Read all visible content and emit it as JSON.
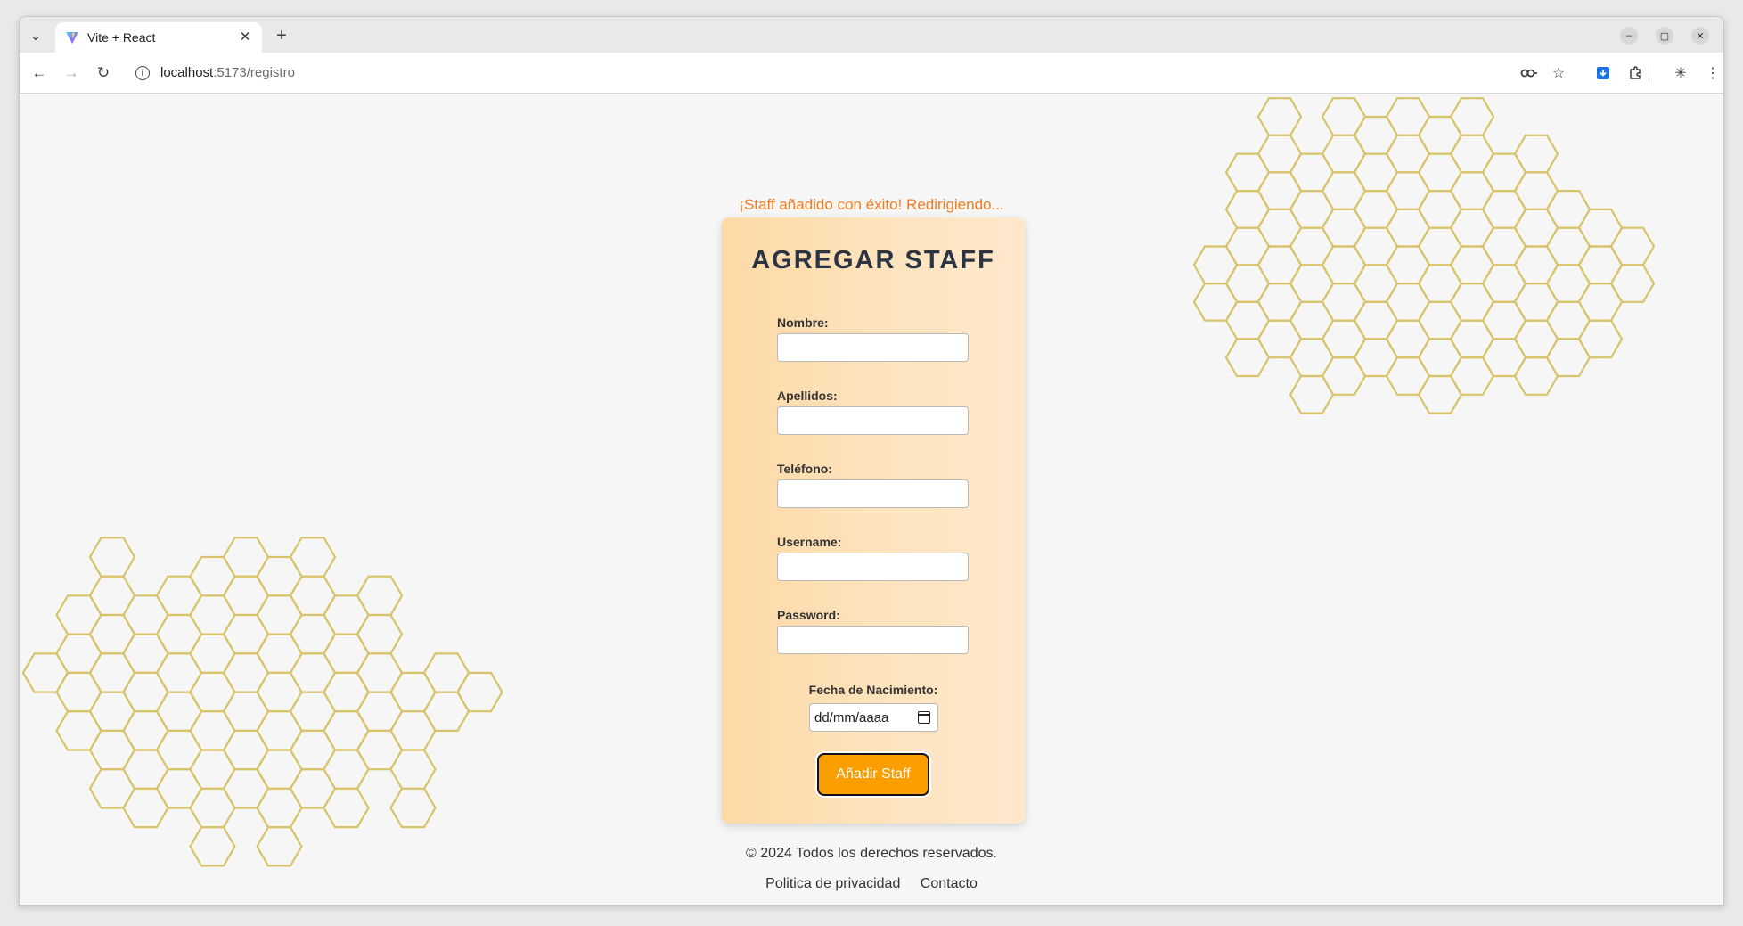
{
  "browser": {
    "tab_title": "Vite + React",
    "url_host": "localhost",
    "url_path": ":5173/registro"
  },
  "page": {
    "success_message": "¡Staff añadido con éxito! Redirigiendo...",
    "form_title": "AGREGAR STAFF",
    "fields": [
      {
        "label": "Nombre:",
        "value": ""
      },
      {
        "label": "Apellidos:",
        "value": ""
      },
      {
        "label": "Teléfono:",
        "value": ""
      },
      {
        "label": "Username:",
        "value": ""
      },
      {
        "label": "Password:",
        "value": ""
      }
    ],
    "date_field": {
      "label": "Fecha de Nacimiento:",
      "placeholder": "dd/mm/aaaa"
    },
    "submit_label": "Añadir Staff",
    "footer_copy": "© 2024 Todos los derechos reservados.",
    "footer_links": [
      "Politica de privacidad",
      "Contacto"
    ]
  },
  "colors": {
    "accent_orange": "#fb9e00",
    "success_text": "#f57c1f",
    "honeycomb_stroke": "#d8c36a"
  }
}
